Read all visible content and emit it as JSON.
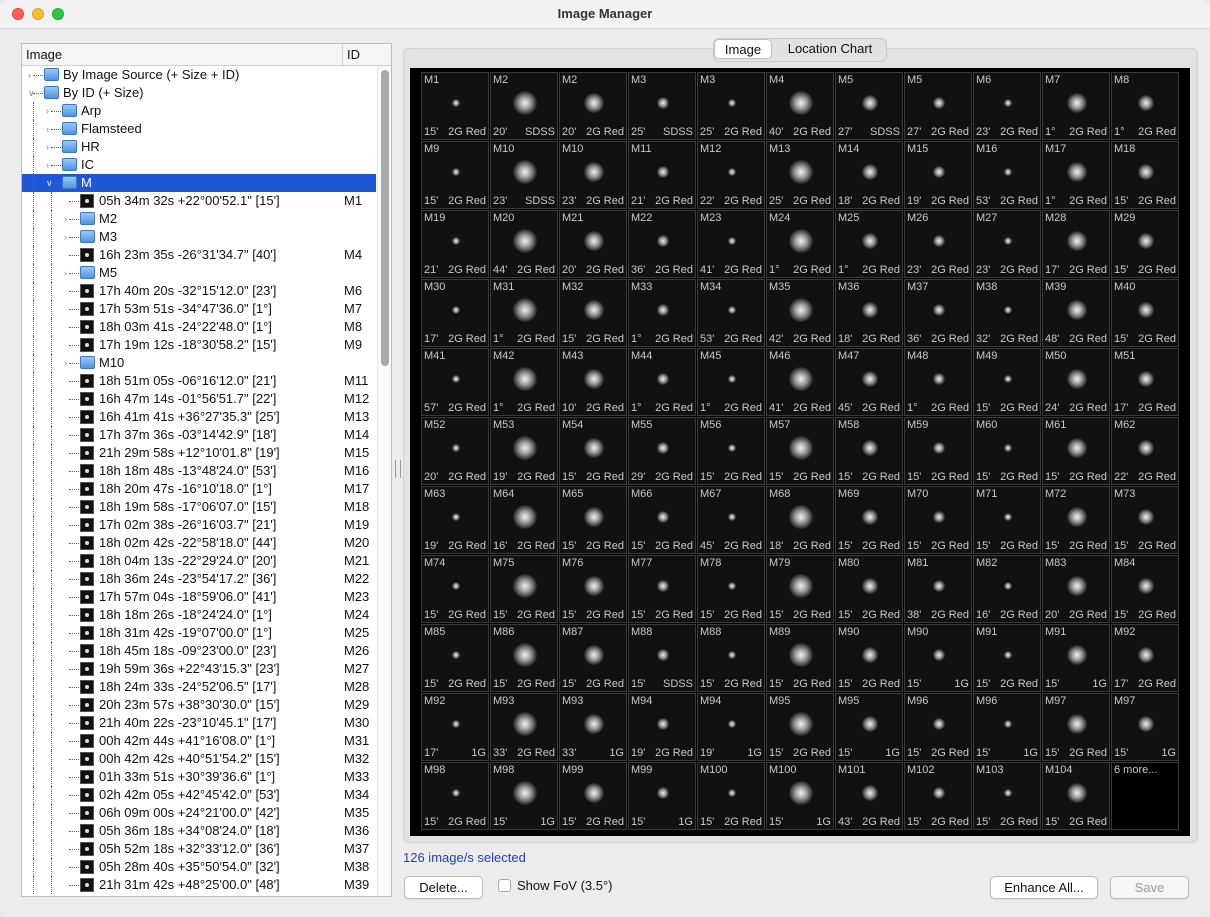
{
  "window": {
    "title": "Image Manager"
  },
  "tree": {
    "col_image": "Image",
    "col_id": "ID",
    "rows": [
      {
        "label": "By Image Source (+ Size + ID)",
        "id": "",
        "kind": "folder",
        "level": 0,
        "open": false
      },
      {
        "label": "By ID (+ Size)",
        "id": "",
        "kind": "folder",
        "level": 0,
        "open": true
      },
      {
        "label": "Arp",
        "id": "",
        "kind": "folder",
        "level": 1,
        "open": false
      },
      {
        "label": "Flamsteed",
        "id": "",
        "kind": "folder",
        "level": 1,
        "open": false
      },
      {
        "label": "HR",
        "id": "",
        "kind": "folder",
        "level": 1,
        "open": false
      },
      {
        "label": "IC",
        "id": "",
        "kind": "folder",
        "level": 1,
        "open": false
      },
      {
        "label": "M",
        "id": "",
        "kind": "folder",
        "level": 1,
        "open": true,
        "selected": true
      },
      {
        "label": "05h 34m 32s  +22°00'52.1\" [15']",
        "id": "M1",
        "kind": "image",
        "level": 2
      },
      {
        "label": "M2",
        "id": "",
        "kind": "folder",
        "level": 2,
        "open": false
      },
      {
        "label": "M3",
        "id": "",
        "kind": "folder",
        "level": 2,
        "open": false
      },
      {
        "label": "16h 23m 35s  -26°31'34.7\" [40']",
        "id": "M4",
        "kind": "image",
        "level": 2
      },
      {
        "label": "M5",
        "id": "",
        "kind": "folder",
        "level": 2,
        "open": false
      },
      {
        "label": "17h 40m 20s  -32°15'12.0\" [23']",
        "id": "M6",
        "kind": "image",
        "level": 2
      },
      {
        "label": "17h 53m 51s  -34°47'36.0\" [1°]",
        "id": "M7",
        "kind": "image",
        "level": 2
      },
      {
        "label": "18h 03m 41s  -24°22'48.0\" [1°]",
        "id": "M8",
        "kind": "image",
        "level": 2
      },
      {
        "label": "17h 19m 12s  -18°30'58.2\" [15']",
        "id": "M9",
        "kind": "image",
        "level": 2
      },
      {
        "label": "M10",
        "id": "",
        "kind": "folder",
        "level": 2,
        "open": false
      },
      {
        "label": "18h 51m 05s  -06°16'12.0\" [21']",
        "id": "M11",
        "kind": "image",
        "level": 2
      },
      {
        "label": "16h 47m 14s  -01°56'51.7\" [22']",
        "id": "M12",
        "kind": "image",
        "level": 2
      },
      {
        "label": "16h 41m 41s  +36°27'35.3\" [25']",
        "id": "M13",
        "kind": "image",
        "level": 2
      },
      {
        "label": "17h 37m 36s  -03°14'42.9\" [18']",
        "id": "M14",
        "kind": "image",
        "level": 2
      },
      {
        "label": "21h 29m 58s  +12°10'01.8\" [19']",
        "id": "M15",
        "kind": "image",
        "level": 2
      },
      {
        "label": "18h 18m 48s  -13°48'24.0\" [53']",
        "id": "M16",
        "kind": "image",
        "level": 2
      },
      {
        "label": "18h 20m 47s  -16°10'18.0\" [1°]",
        "id": "M17",
        "kind": "image",
        "level": 2
      },
      {
        "label": "18h 19m 58s  -17°06'07.0\" [15']",
        "id": "M18",
        "kind": "image",
        "level": 2
      },
      {
        "label": "17h 02m 38s  -26°16'03.7\" [21']",
        "id": "M19",
        "kind": "image",
        "level": 2
      },
      {
        "label": "18h 02m 42s  -22°58'18.0\" [44']",
        "id": "M20",
        "kind": "image",
        "level": 2
      },
      {
        "label": "18h 04m 13s  -22°29'24.0\" [20']",
        "id": "M21",
        "kind": "image",
        "level": 2
      },
      {
        "label": "18h 36m 24s  -23°54'17.2\" [36']",
        "id": "M22",
        "kind": "image",
        "level": 2
      },
      {
        "label": "17h 57m 04s  -18°59'06.0\" [41']",
        "id": "M23",
        "kind": "image",
        "level": 2
      },
      {
        "label": "18h 18m 26s  -18°24'24.0\" [1°]",
        "id": "M24",
        "kind": "image",
        "level": 2
      },
      {
        "label": "18h 31m 42s  -19°07'00.0\" [1°]",
        "id": "M25",
        "kind": "image",
        "level": 2
      },
      {
        "label": "18h 45m 18s  -09°23'00.0\" [23']",
        "id": "M26",
        "kind": "image",
        "level": 2
      },
      {
        "label": "19h 59m 36s  +22°43'15.3\" [23']",
        "id": "M27",
        "kind": "image",
        "level": 2
      },
      {
        "label": "18h 24m 33s  -24°52'06.5\" [17']",
        "id": "M28",
        "kind": "image",
        "level": 2
      },
      {
        "label": "20h 23m 57s  +38°30'30.0\" [15']",
        "id": "M29",
        "kind": "image",
        "level": 2
      },
      {
        "label": "21h 40m 22s  -23°10'45.1\" [17']",
        "id": "M30",
        "kind": "image",
        "level": 2
      },
      {
        "label": "00h 42m 44s  +41°16'08.0\" [1°]",
        "id": "M31",
        "kind": "image",
        "level": 2
      },
      {
        "label": "00h 42m 42s  +40°51'54.2\" [15']",
        "id": "M32",
        "kind": "image",
        "level": 2
      },
      {
        "label": "01h 33m 51s  +30°39'36.6\" [1°]",
        "id": "M33",
        "kind": "image",
        "level": 2
      },
      {
        "label": "02h 42m 05s  +42°45'42.0\" [53']",
        "id": "M34",
        "kind": "image",
        "level": 2
      },
      {
        "label": "06h 09m 00s  +24°21'00.0\" [42']",
        "id": "M35",
        "kind": "image",
        "level": 2
      },
      {
        "label": "05h 36m 18s  +34°08'24.0\" [18']",
        "id": "M36",
        "kind": "image",
        "level": 2
      },
      {
        "label": "05h 52m 18s  +32°33'12.0\" [36']",
        "id": "M37",
        "kind": "image",
        "level": 2
      },
      {
        "label": "05h 28m 40s  +35°50'54.0\" [32']",
        "id": "M38",
        "kind": "image",
        "level": 2
      },
      {
        "label": "21h 31m 42s  +48°25'00.0\" [48']",
        "id": "M39",
        "kind": "image",
        "level": 2
      }
    ]
  },
  "tabs": [
    {
      "label": "Image",
      "active": true
    },
    {
      "label": "Location Chart",
      "active": false
    }
  ],
  "thumbnails": [
    [
      "M1",
      "15'",
      "2G Red"
    ],
    [
      "M2",
      "20'",
      "SDSS"
    ],
    [
      "M2",
      "20'",
      "2G Red"
    ],
    [
      "M3",
      "25'",
      "SDSS"
    ],
    [
      "M3",
      "25'",
      "2G Red"
    ],
    [
      "M4",
      "40'",
      "2G Red"
    ],
    [
      "M5",
      "27'",
      "SDSS"
    ],
    [
      "M5",
      "27'",
      "2G Red"
    ],
    [
      "M6",
      "23'",
      "2G Red"
    ],
    [
      "M7",
      "1°",
      "2G Red"
    ],
    [
      "M8",
      "1°",
      "2G Red"
    ],
    [
      "M9",
      "15'",
      "2G Red"
    ],
    [
      "M10",
      "23'",
      "SDSS"
    ],
    [
      "M10",
      "23'",
      "2G Red"
    ],
    [
      "M11",
      "21'",
      "2G Red"
    ],
    [
      "M12",
      "22'",
      "2G Red"
    ],
    [
      "M13",
      "25'",
      "2G Red"
    ],
    [
      "M14",
      "18'",
      "2G Red"
    ],
    [
      "M15",
      "19'",
      "2G Red"
    ],
    [
      "M16",
      "53'",
      "2G Red"
    ],
    [
      "M17",
      "1°",
      "2G Red"
    ],
    [
      "M18",
      "15'",
      "2G Red"
    ],
    [
      "M19",
      "21'",
      "2G Red"
    ],
    [
      "M20",
      "44'",
      "2G Red"
    ],
    [
      "M21",
      "20'",
      "2G Red"
    ],
    [
      "M22",
      "36'",
      "2G Red"
    ],
    [
      "M23",
      "41'",
      "2G Red"
    ],
    [
      "M24",
      "1°",
      "2G Red"
    ],
    [
      "M25",
      "1°",
      "2G Red"
    ],
    [
      "M26",
      "23'",
      "2G Red"
    ],
    [
      "M27",
      "23'",
      "2G Red"
    ],
    [
      "M28",
      "17'",
      "2G Red"
    ],
    [
      "M29",
      "15'",
      "2G Red"
    ],
    [
      "M30",
      "17'",
      "2G Red"
    ],
    [
      "M31",
      "1°",
      "2G Red"
    ],
    [
      "M32",
      "15'",
      "2G Red"
    ],
    [
      "M33",
      "1°",
      "2G Red"
    ],
    [
      "M34",
      "53'",
      "2G Red"
    ],
    [
      "M35",
      "42'",
      "2G Red"
    ],
    [
      "M36",
      "18'",
      "2G Red"
    ],
    [
      "M37",
      "36'",
      "2G Red"
    ],
    [
      "M38",
      "32'",
      "2G Red"
    ],
    [
      "M39",
      "48'",
      "2G Red"
    ],
    [
      "M40",
      "15'",
      "2G Red"
    ],
    [
      "M41",
      "57'",
      "2G Red"
    ],
    [
      "M42",
      "1°",
      "2G Red"
    ],
    [
      "M43",
      "10'",
      "2G Red"
    ],
    [
      "M44",
      "1°",
      "2G Red"
    ],
    [
      "M45",
      "1°",
      "2G Red"
    ],
    [
      "M46",
      "41'",
      "2G Red"
    ],
    [
      "M47",
      "45'",
      "2G Red"
    ],
    [
      "M48",
      "1°",
      "2G Red"
    ],
    [
      "M49",
      "15'",
      "2G Red"
    ],
    [
      "M50",
      "24'",
      "2G Red"
    ],
    [
      "M51",
      "17'",
      "2G Red"
    ],
    [
      "M52",
      "20'",
      "2G Red"
    ],
    [
      "M53",
      "19'",
      "2G Red"
    ],
    [
      "M54",
      "15'",
      "2G Red"
    ],
    [
      "M55",
      "29'",
      "2G Red"
    ],
    [
      "M56",
      "15'",
      "2G Red"
    ],
    [
      "M57",
      "15'",
      "2G Red"
    ],
    [
      "M58",
      "15'",
      "2G Red"
    ],
    [
      "M59",
      "15'",
      "2G Red"
    ],
    [
      "M60",
      "15'",
      "2G Red"
    ],
    [
      "M61",
      "15'",
      "2G Red"
    ],
    [
      "M62",
      "22'",
      "2G Red"
    ],
    [
      "M63",
      "19'",
      "2G Red"
    ],
    [
      "M64",
      "16'",
      "2G Red"
    ],
    [
      "M65",
      "15'",
      "2G Red"
    ],
    [
      "M66",
      "15'",
      "2G Red"
    ],
    [
      "M67",
      "45'",
      "2G Red"
    ],
    [
      "M68",
      "18'",
      "2G Red"
    ],
    [
      "M69",
      "15'",
      "2G Red"
    ],
    [
      "M70",
      "15'",
      "2G Red"
    ],
    [
      "M71",
      "15'",
      "2G Red"
    ],
    [
      "M72",
      "15'",
      "2G Red"
    ],
    [
      "M73",
      "15'",
      "2G Red"
    ],
    [
      "M74",
      "15'",
      "2G Red"
    ],
    [
      "M75",
      "15'",
      "2G Red"
    ],
    [
      "M76",
      "15'",
      "2G Red"
    ],
    [
      "M77",
      "15'",
      "2G Red"
    ],
    [
      "M78",
      "15'",
      "2G Red"
    ],
    [
      "M79",
      "15'",
      "2G Red"
    ],
    [
      "M80",
      "15'",
      "2G Red"
    ],
    [
      "M81",
      "38'",
      "2G Red"
    ],
    [
      "M82",
      "16'",
      "2G Red"
    ],
    [
      "M83",
      "20'",
      "2G Red"
    ],
    [
      "M84",
      "15'",
      "2G Red"
    ],
    [
      "M85",
      "15'",
      "2G Red"
    ],
    [
      "M86",
      "15'",
      "2G Red"
    ],
    [
      "M87",
      "15'",
      "2G Red"
    ],
    [
      "M88",
      "15'",
      "SDSS"
    ],
    [
      "M88",
      "15'",
      "2G Red"
    ],
    [
      "M89",
      "15'",
      "2G Red"
    ],
    [
      "M90",
      "15'",
      "2G Red"
    ],
    [
      "M90",
      "15'",
      "1G"
    ],
    [
      "M91",
      "15'",
      "2G Red"
    ],
    [
      "M91",
      "15'",
      "1G"
    ],
    [
      "M92",
      "17'",
      "2G Red"
    ],
    [
      "M92",
      "17'",
      "1G"
    ],
    [
      "M93",
      "33'",
      "2G Red"
    ],
    [
      "M93",
      "33'",
      "1G"
    ],
    [
      "M94",
      "19'",
      "2G Red"
    ],
    [
      "M94",
      "19'",
      "1G"
    ],
    [
      "M95",
      "15'",
      "2G Red"
    ],
    [
      "M95",
      "15'",
      "1G"
    ],
    [
      "M96",
      "15'",
      "2G Red"
    ],
    [
      "M96",
      "15'",
      "1G"
    ],
    [
      "M97",
      "15'",
      "2G Red"
    ],
    [
      "M97",
      "15'",
      "1G"
    ],
    [
      "M98",
      "15'",
      "2G Red"
    ],
    [
      "M98",
      "15'",
      "1G"
    ],
    [
      "M99",
      "15'",
      "2G Red"
    ],
    [
      "M99",
      "15'",
      "1G"
    ],
    [
      "M100",
      "15'",
      "2G Red"
    ],
    [
      "M100",
      "15'",
      "1G"
    ],
    [
      "M101",
      "43'",
      "2G Red"
    ],
    [
      "M102",
      "15'",
      "2G Red"
    ],
    [
      "M103",
      "15'",
      "2G Red"
    ],
    [
      "M104",
      "15'",
      "2G Red"
    ],
    [
      "6 more...",
      "",
      ""
    ]
  ],
  "status": {
    "selected_text": "126 image/s selected"
  },
  "buttons": {
    "delete": "Delete...",
    "show_fov": "Show FoV (3.5°)",
    "enhance_all": "Enhance All...",
    "save": "Save"
  },
  "colors": {
    "selection": "#1f57d6",
    "status_text": "#1d3fb8"
  }
}
